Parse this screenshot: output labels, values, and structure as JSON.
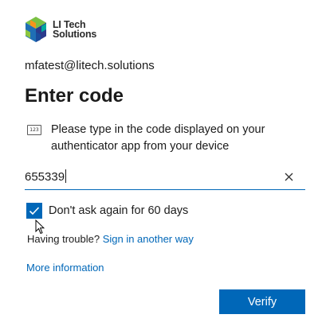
{
  "logo": {
    "line1": "LI Tech",
    "line2": "Solutions"
  },
  "account": {
    "email": "mfatest@litech.solutions"
  },
  "page": {
    "title": "Enter code"
  },
  "instruction": {
    "icon_text": "123",
    "text": "Please type in the code displayed on your authenticator app from your device"
  },
  "code_field": {
    "value": "655339"
  },
  "remember": {
    "label": "Don't ask again for 60 days",
    "checked": true
  },
  "help": {
    "trouble_label": "Having trouble?",
    "sign_in_another_way": "Sign in another way",
    "more_information": "More information"
  },
  "actions": {
    "verify_label": "Verify"
  },
  "colors": {
    "accent": "#0067b8",
    "text": "#1b1b1b"
  }
}
